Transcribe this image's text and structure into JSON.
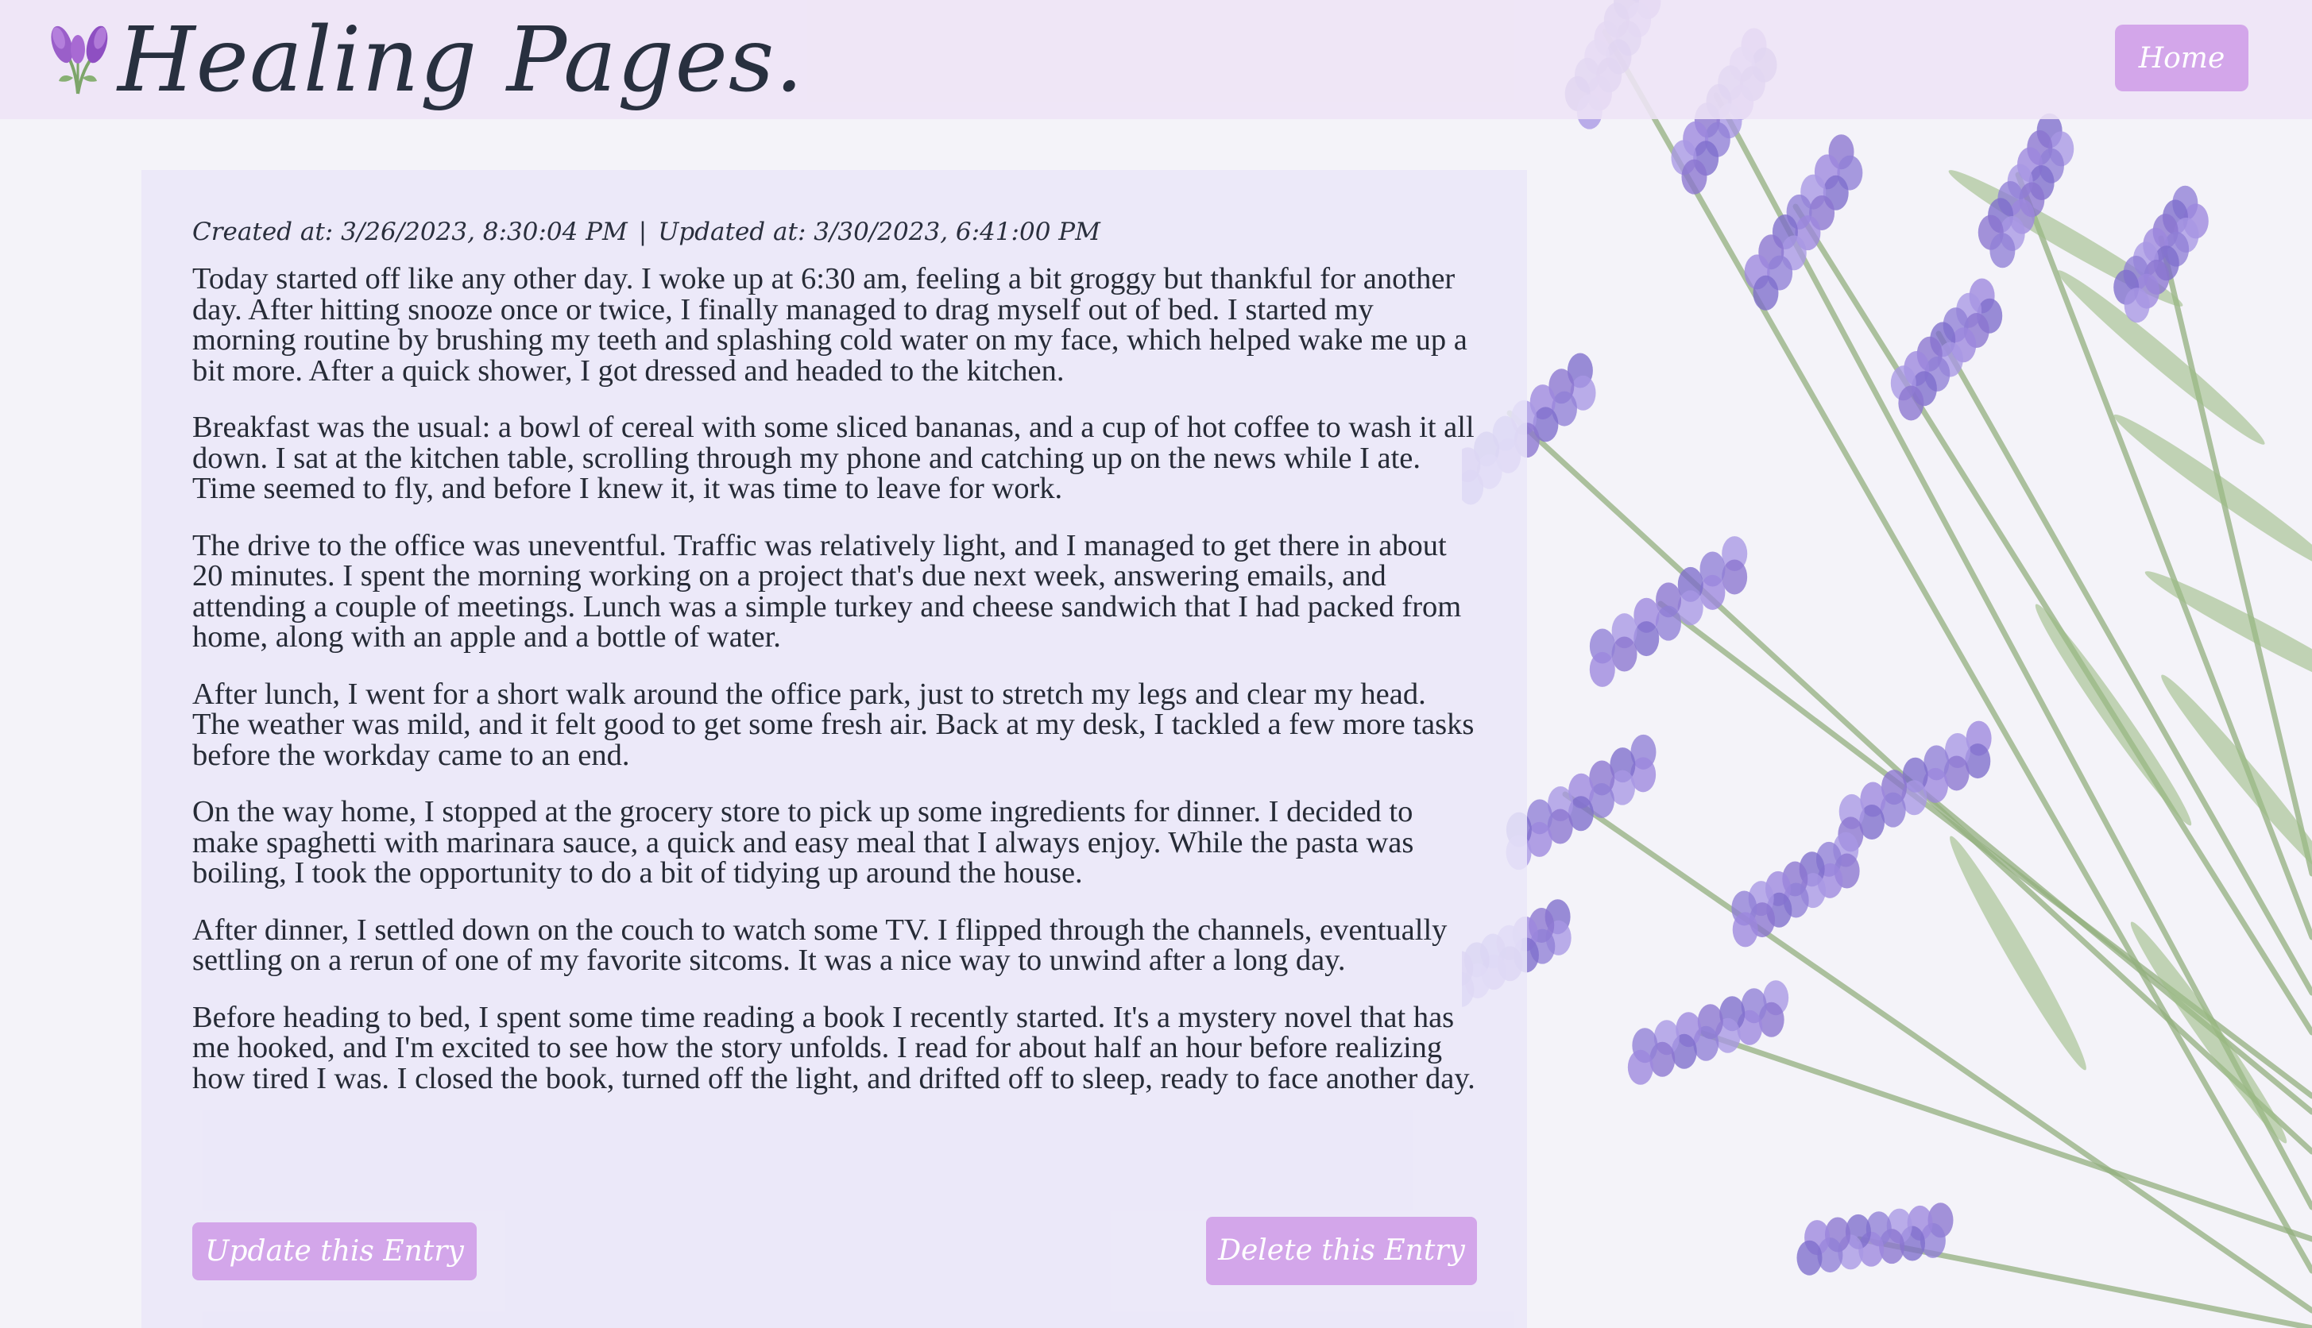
{
  "header": {
    "title": "Healing Pages.",
    "logo_icon": "lavender-icon",
    "home_label": "Home"
  },
  "entry": {
    "created_label": "Created at:",
    "created_at": "3/26/2023, 8:30:04 PM",
    "separator": "|",
    "updated_label": "Updated at:",
    "updated_at": "3/30/2023, 6:41:00 PM",
    "paragraphs": [
      "Today started off like any other day. I woke up at 6:30 am, feeling a bit groggy but thankful for another day. After hitting snooze once or twice, I finally managed to drag myself out of bed. I started my morning routine by brushing my teeth and splashing cold water on my face, which helped wake me up a bit more. After a quick shower, I got dressed and headed to the kitchen.",
      "Breakfast was the usual: a bowl of cereal with some sliced bananas, and a cup of hot coffee to wash it all down. I sat at the kitchen table, scrolling through my phone and catching up on the news while I ate. Time seemed to fly, and before I knew it, it was time to leave for work.",
      "The drive to the office was uneventful. Traffic was relatively light, and I managed to get there in about 20 minutes. I spent the morning working on a project that's due next week, answering emails, and attending a couple of meetings. Lunch was a simple turkey and cheese sandwich that I had packed from home, along with an apple and a bottle of water.",
      "After lunch, I went for a short walk around the office park, just to stretch my legs and clear my head. The weather was mild, and it felt good to get some fresh air. Back at my desk, I tackled a few more tasks before the workday came to an end.",
      "On the way home, I stopped at the grocery store to pick up some ingredients for dinner. I decided to make spaghetti with marinara sauce, a quick and easy meal that I always enjoy. While the pasta was boiling, I took the opportunity to do a bit of tidying up around the house.",
      "After dinner, I settled down on the couch to watch some TV. I flipped through the channels, eventually settling on a rerun of one of my favorite sitcoms. It was a nice way to unwind after a long day.",
      "Before heading to bed, I spent some time reading a book I recently started. It's a mystery novel that has me hooked, and I'm excited to see how the story unfolds. I read for about half an hour before realizing how tired I was. I closed the book, turned off the light, and drifted off to sleep, ready to face another day."
    ],
    "update_label": "Update this Entry",
    "delete_label": "Delete this Entry"
  },
  "background": {
    "image": "lavender-bouquet"
  },
  "colors": {
    "accent": "#d3a6ea",
    "header_bg": "#eee4f6",
    "card_bg": "#eae6f9",
    "text": "#262b36",
    "page_bg": "#f4f3f9"
  }
}
